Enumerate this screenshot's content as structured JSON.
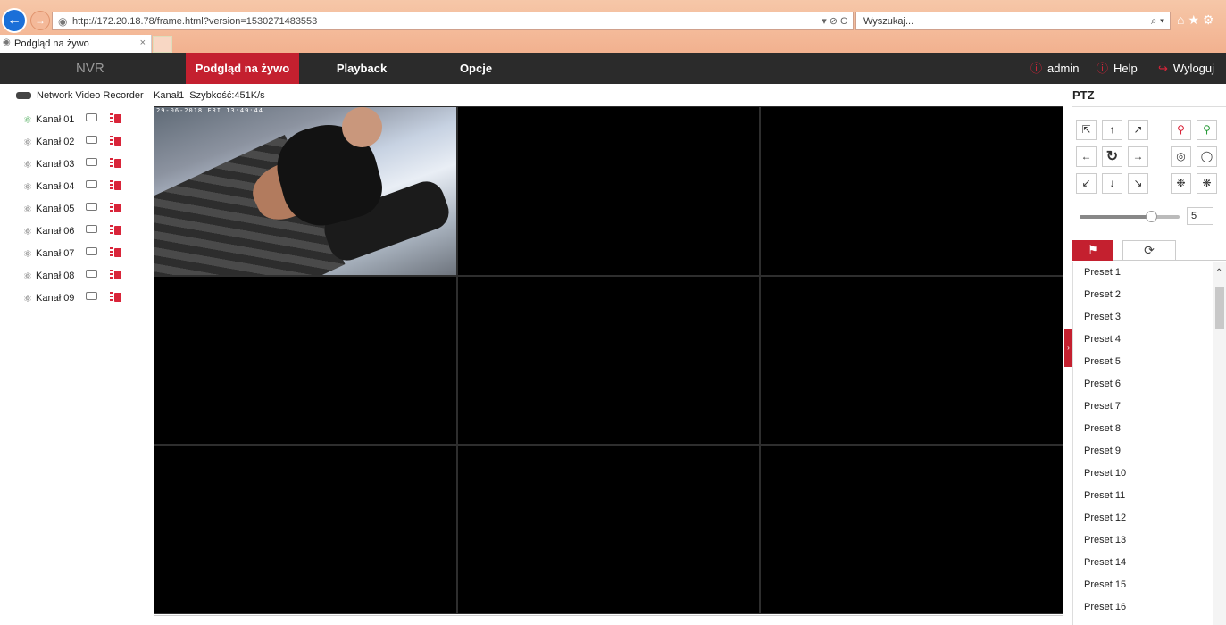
{
  "browser": {
    "back": "←",
    "forward": "→",
    "url": "http://172.20.18.78/frame.html?version=1530271483553",
    "address_controls": "▾ ⊘ C",
    "search_placeholder": "Wyszukaj...",
    "search_icon": "⌕ ▾",
    "tab_title": "Podgląd na żywo",
    "tab_close": "×",
    "toolbar_icons": "⌂★⚙"
  },
  "header": {
    "logo": "NVR",
    "tabs": [
      "Podgląd na żywo",
      "Playback",
      "Opcje"
    ],
    "user": "admin",
    "help": "Help",
    "logout": "Wyloguj",
    "colors": {
      "bar": "#2b2b2b",
      "accent": "#c4202f"
    }
  },
  "sidebar": {
    "device": "Network Video Recorder",
    "channels": [
      {
        "label": "Kanał 01",
        "active": true
      },
      {
        "label": "Kanał 02",
        "active": false
      },
      {
        "label": "Kanał 03",
        "active": false
      },
      {
        "label": "Kanał 04",
        "active": false
      },
      {
        "label": "Kanał 05",
        "active": false
      },
      {
        "label": "Kanał 06",
        "active": false
      },
      {
        "label": "Kanał 07",
        "active": false
      },
      {
        "label": "Kanał 08",
        "active": false
      },
      {
        "label": "Kanał 09",
        "active": false
      }
    ]
  },
  "video": {
    "status_channel": "Kanał1",
    "status_speed": "Szybkość:451K/s",
    "osd_timestamp": "29-06-2018 FRI 13:49:44",
    "grid": "3x3",
    "selected_cell": 1
  },
  "ptz": {
    "title": "PTZ",
    "speed": 5,
    "speed_max": 7,
    "tab_preset_icon": "flag-icon",
    "tab_patrol_icon": "cycle-icon",
    "presets": [
      "Preset 1",
      "Preset 2",
      "Preset 3",
      "Preset 4",
      "Preset 5",
      "Preset 6",
      "Preset 7",
      "Preset 8",
      "Preset 9",
      "Preset 10",
      "Preset 11",
      "Preset 12",
      "Preset 13",
      "Preset 14",
      "Preset 15",
      "Preset 16"
    ]
  }
}
